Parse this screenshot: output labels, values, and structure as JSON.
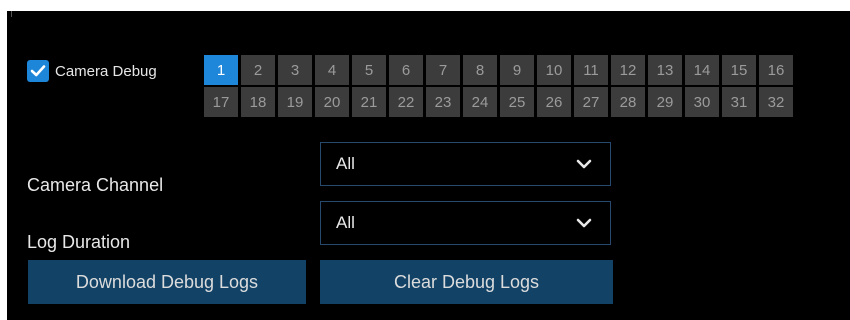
{
  "camera_debug": {
    "label": "Camera Debug",
    "checked": true,
    "selected_channel": "1",
    "channels": [
      "1",
      "2",
      "3",
      "4",
      "5",
      "6",
      "7",
      "8",
      "9",
      "10",
      "11",
      "12",
      "13",
      "14",
      "15",
      "16",
      "17",
      "18",
      "19",
      "20",
      "21",
      "22",
      "23",
      "24",
      "25",
      "26",
      "27",
      "28",
      "29",
      "30",
      "31",
      "32"
    ]
  },
  "camera_channel": {
    "label": "Camera Channel",
    "value": "All"
  },
  "log_duration": {
    "label": "Log Duration",
    "value": "All"
  },
  "buttons": {
    "download": "Download Debug Logs",
    "clear": "Clear Debug Logs"
  },
  "colors": {
    "accent": "#1f87da",
    "button_bg": "#124266",
    "tile_bg": "#3c3c3c",
    "panel_bg": "#000000"
  }
}
